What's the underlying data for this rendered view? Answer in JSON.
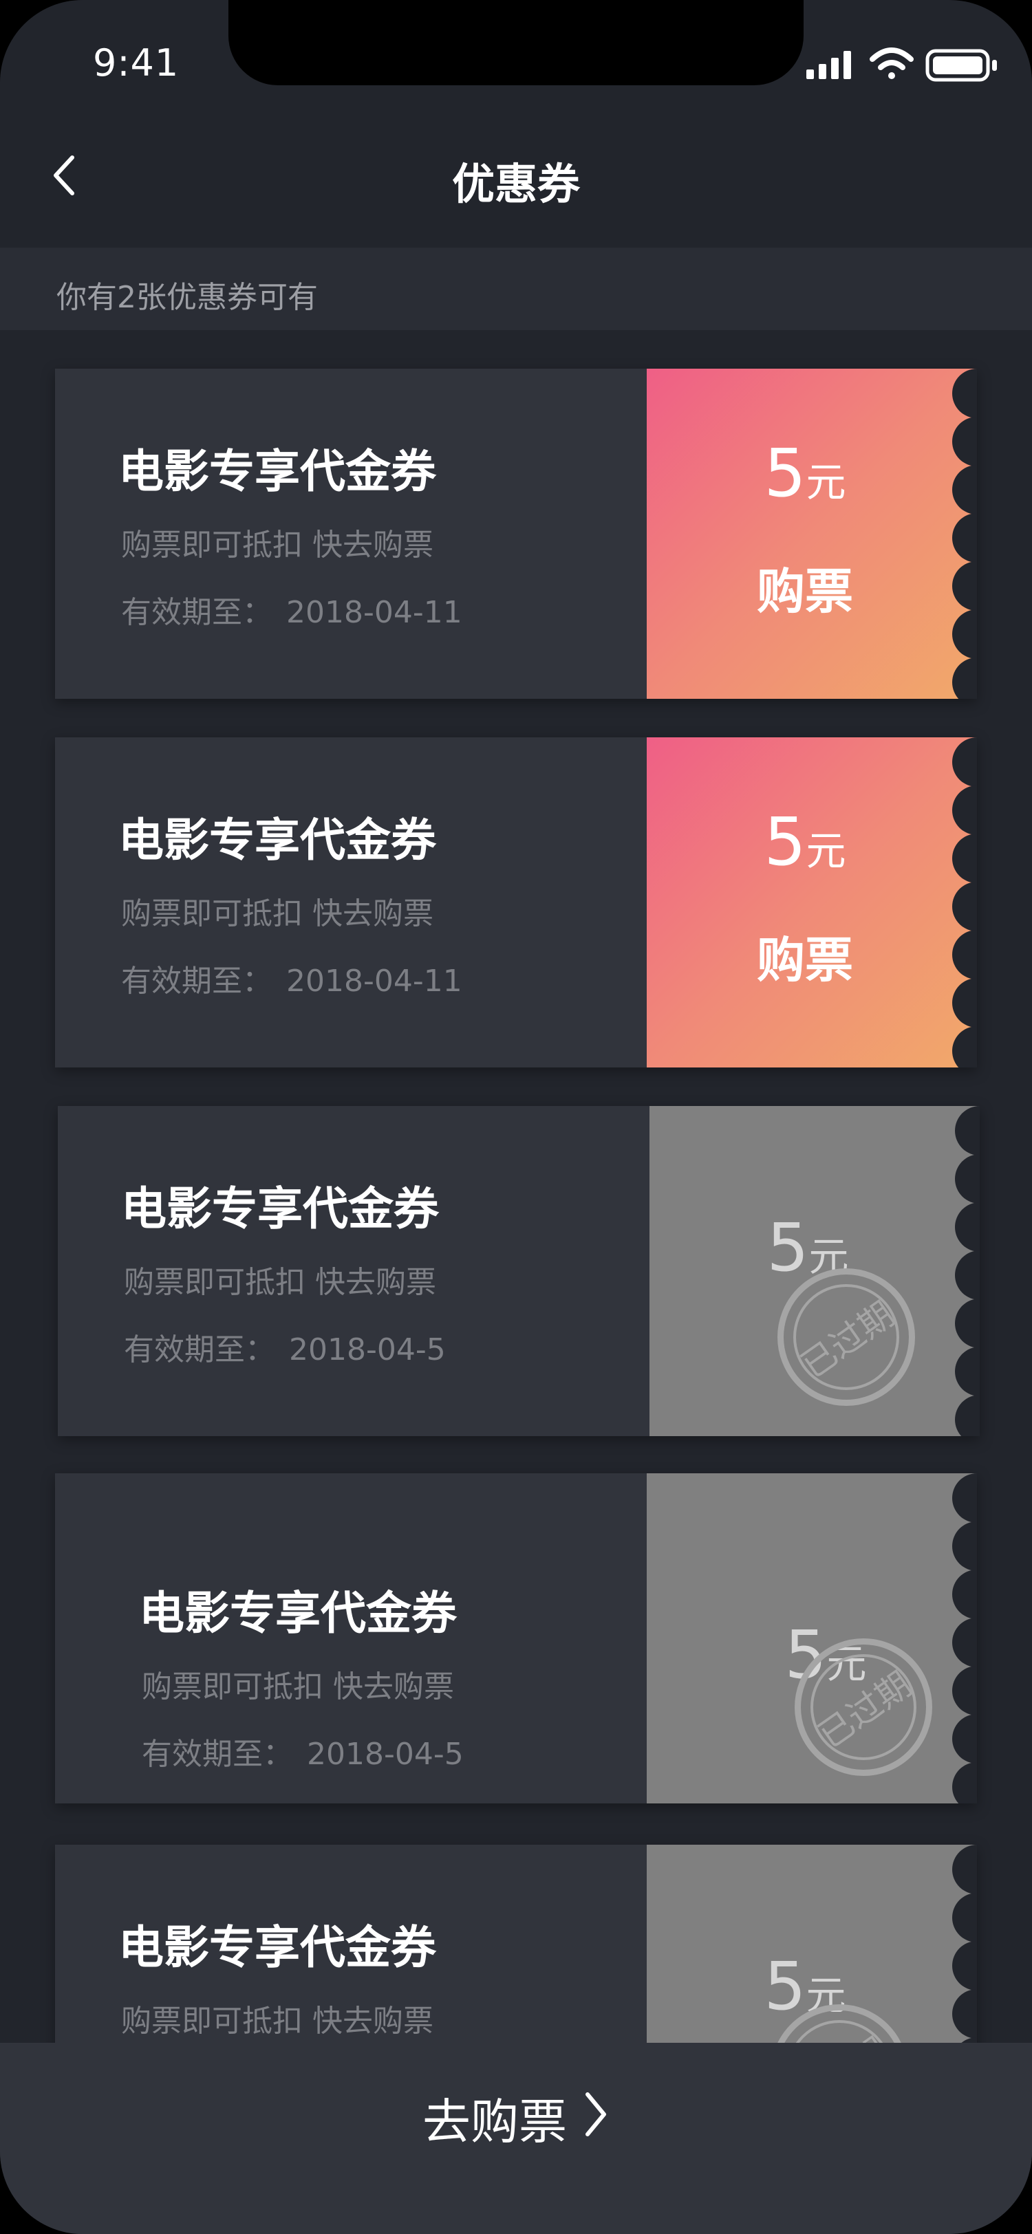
{
  "status_bar": {
    "time": "9:41",
    "icons": [
      "signal-icon",
      "wifi-icon",
      "battery-icon"
    ]
  },
  "nav": {
    "back_icon": "chevron-left-icon",
    "title": "优惠券"
  },
  "info": {
    "text": "你有2张优惠券可有"
  },
  "coupons": [
    {
      "name": "电影专享代金券",
      "desc": "购票即可抵扣 快去购票",
      "valid_label": "有效期至：",
      "valid_date": "2018-04-11",
      "amount": "5",
      "unit": "元",
      "action": "购票",
      "status": "active"
    },
    {
      "name": "电影专享代金券",
      "desc": "购票即可抵扣 快去购票",
      "valid_label": "有效期至：",
      "valid_date": "2018-04-11",
      "amount": "5",
      "unit": "元",
      "action": "购票",
      "status": "active"
    },
    {
      "name": "电影专享代金券",
      "desc": "购票即可抵扣 快去购票",
      "valid_label": "有效期至：",
      "valid_date": "2018-04-5",
      "amount": "5",
      "unit": "元",
      "stamp": "已过期",
      "status": "expired"
    },
    {
      "name": "电影专享代金券",
      "desc": "购票即可抵扣 快去购票",
      "valid_label": "有效期至：",
      "valid_date": "2018-04-5",
      "amount": "5",
      "unit": "元",
      "stamp": "已过期",
      "status": "expired"
    },
    {
      "name": "电影专享代金券",
      "desc": "购票即可抵扣 快去购票",
      "amount": "5",
      "unit": "元",
      "stamp": "已过期",
      "status": "expired"
    }
  ],
  "bottom": {
    "button_label": "去购票",
    "button_icon": "chevron-right-icon"
  },
  "colors": {
    "background": "#22252c",
    "card": "#31343c",
    "active_gradient_start": "#ef5f86",
    "active_gradient_end": "#f1a96a",
    "expired": "#808080"
  }
}
